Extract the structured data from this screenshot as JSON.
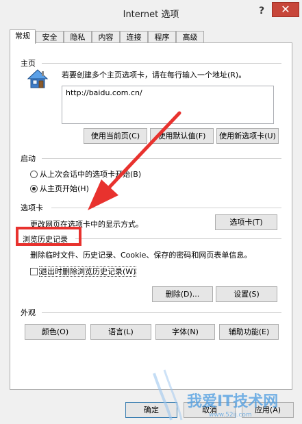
{
  "window": {
    "title": "Internet 选项",
    "help": "?",
    "close": "✕"
  },
  "tabs": [
    {
      "label": "常规",
      "active": true
    },
    {
      "label": "安全",
      "active": false
    },
    {
      "label": "隐私",
      "active": false
    },
    {
      "label": "内容",
      "active": false
    },
    {
      "label": "连接",
      "active": false
    },
    {
      "label": "程序",
      "active": false
    },
    {
      "label": "高级",
      "active": false
    }
  ],
  "homepage": {
    "title": "主页",
    "icon": "house-icon",
    "description": "若要创建多个主页选项卡，请在每行输入一个地址(R)。",
    "url": "http://baidu.com.cn/",
    "buttons": {
      "use_current": "使用当前页(C)",
      "use_default": "使用默认值(F)",
      "use_new_tab": "使用新选项卡(U)"
    }
  },
  "startup": {
    "title": "启动",
    "option_last_session": "从上次会话中的选项卡开始(B)",
    "option_homepage": "从主页开始(H)",
    "selected": "option_homepage"
  },
  "tabs_section": {
    "title": "选项卡",
    "description": "更改网页在选项卡中的显示方式。",
    "button": "选项卡(T)"
  },
  "history": {
    "title": "浏览历史记录",
    "description": "删除临时文件、历史记录、Cookie、保存的密码和网页表单信息。",
    "checkbox": "退出时删除浏览历史记录(W)",
    "checked": false,
    "delete_button": "删除(D)...",
    "settings_button": "设置(S)"
  },
  "appearance": {
    "title": "外观",
    "colors": "颜色(O)",
    "languages": "语言(L)",
    "fonts": "字体(N)",
    "accessibility": "辅助功能(E)"
  },
  "footer": {
    "ok": "确定",
    "cancel": "取消",
    "apply": "应用(A)"
  },
  "watermark": {
    "text": "我爱IT技术网",
    "sub": "www.52ij.com"
  },
  "colors": {
    "highlight_box": "#e8322e",
    "close_button": "#c7463a"
  }
}
